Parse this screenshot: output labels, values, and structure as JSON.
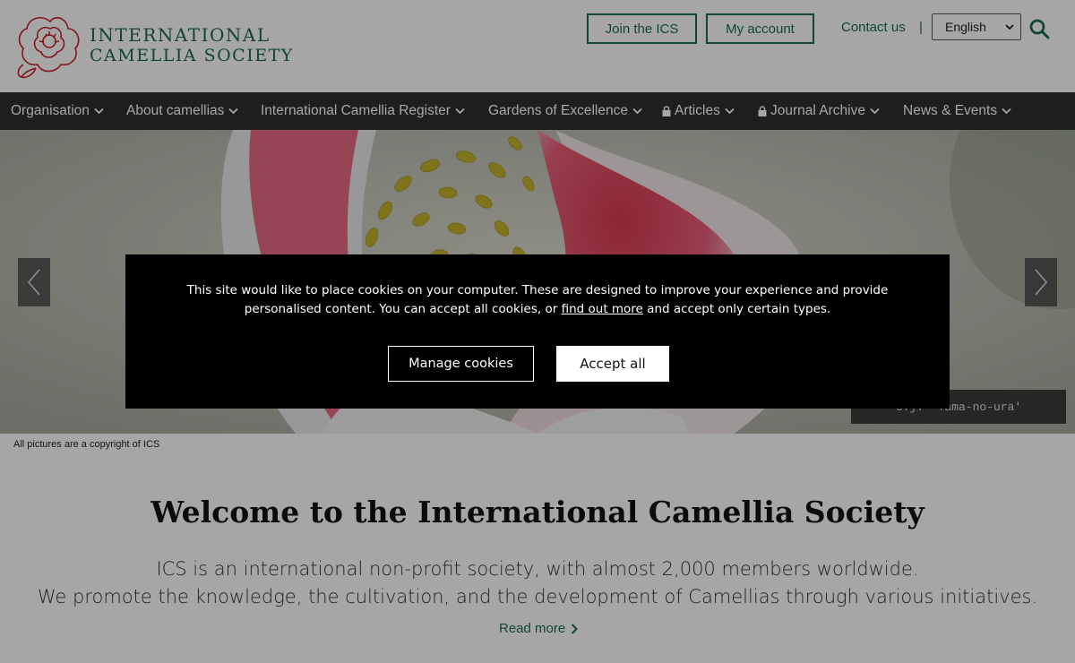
{
  "header": {
    "logo_line1": "INTERNATIONAL",
    "logo_line2": "CAMELLIA SOCIETY",
    "join_label": "Join the ICS",
    "account_label": "My account",
    "contact_label": "Contact us",
    "separator": "|",
    "language_selected": "English"
  },
  "nav": {
    "items": [
      {
        "label": "Organisation",
        "locked": false
      },
      {
        "label": "About camellias",
        "locked": false
      },
      {
        "label": "International Camellia Register",
        "locked": false
      },
      {
        "label": "Gardens of Excellence",
        "locked": false
      },
      {
        "label": "Articles",
        "locked": true
      },
      {
        "label": "Journal Archive",
        "locked": true
      },
      {
        "label": "News & Events",
        "locked": false
      }
    ]
  },
  "hero": {
    "caption": "C.j. 'Tama-no-ura'"
  },
  "copyright": "All pictures are a copyright of ICS",
  "main": {
    "welcome_title": "Welcome to the International Camellia Society",
    "intro_line1": "ICS is an international non-profit society, with almost 2,000 members worldwide.",
    "intro_line2": "We promote the knowledge, the cultivation, and the development of Camellias through various initiatives.",
    "read_more_label": "Read more"
  },
  "cookie": {
    "text_before_link": "This site would like to place cookies on your computer. These are designed to improve your experience and provide personalised content. You can accept all cookies, or ",
    "link_text": "find out more",
    "text_after_link": " and accept only certain types.",
    "manage_label": "Manage cookies",
    "accept_label": "Accept all"
  },
  "colors": {
    "brand_green": "#1d6b4a",
    "nav_background": "#2c302b",
    "logo_red": "#c8202a"
  }
}
